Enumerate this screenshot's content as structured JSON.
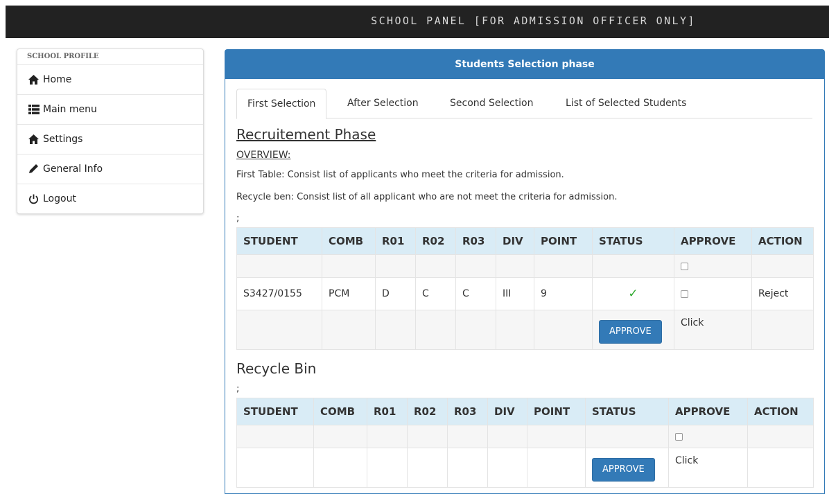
{
  "header": {
    "title": "SCHOOL PANEL [FOR ADMISSION OFFICER ONLY]"
  },
  "sidebar": {
    "heading": "SCHOOL PROFILE",
    "items": [
      {
        "label": "Home",
        "icon": "home-icon"
      },
      {
        "label": "Main menu",
        "icon": "list-icon"
      },
      {
        "label": "Settings",
        "icon": "home-icon"
      },
      {
        "label": "General Info",
        "icon": "pencil-icon"
      },
      {
        "label": "Logout",
        "icon": "power-icon"
      }
    ]
  },
  "panel": {
    "title": "Students Selection phase"
  },
  "tabs": [
    {
      "label": "First Selection",
      "active": true
    },
    {
      "label": "After Selection",
      "active": false
    },
    {
      "label": "Second Selection",
      "active": false
    },
    {
      "label": "List of Selected Students",
      "active": false
    }
  ],
  "content": {
    "heading": "Recruitement Phase",
    "overview_label": "OVERVIEW:",
    "para1": "First Table: Consist list of applicants who meet the criteria for admission.",
    "para2": "Recycle ben: Consist list of all applicant who are not meet the criteria for admission.",
    "semicolon": ";",
    "recycle_heading": "Recycle Bin"
  },
  "table_columns": [
    "STUDENT",
    "COMB",
    "R01",
    "R02",
    "R03",
    "DIV",
    "POINT",
    "STATUS",
    "APPROVE",
    "ACTION"
  ],
  "first_table": {
    "row": {
      "student": "S3427/0155",
      "comb": "PCM",
      "r01": "D",
      "r02": "C",
      "r03": "C",
      "div": "III",
      "point": "9",
      "status_icon": "✓",
      "action": "Reject"
    },
    "approve_button": "APPROVE",
    "click_text": "Click"
  },
  "recycle_table": {
    "approve_button": "APPROVE",
    "click_text": "Click"
  },
  "colors": {
    "primary": "#337ab7",
    "topbar": "#222222",
    "table_header": "#d9ecf6",
    "check": "#2ea92e"
  }
}
